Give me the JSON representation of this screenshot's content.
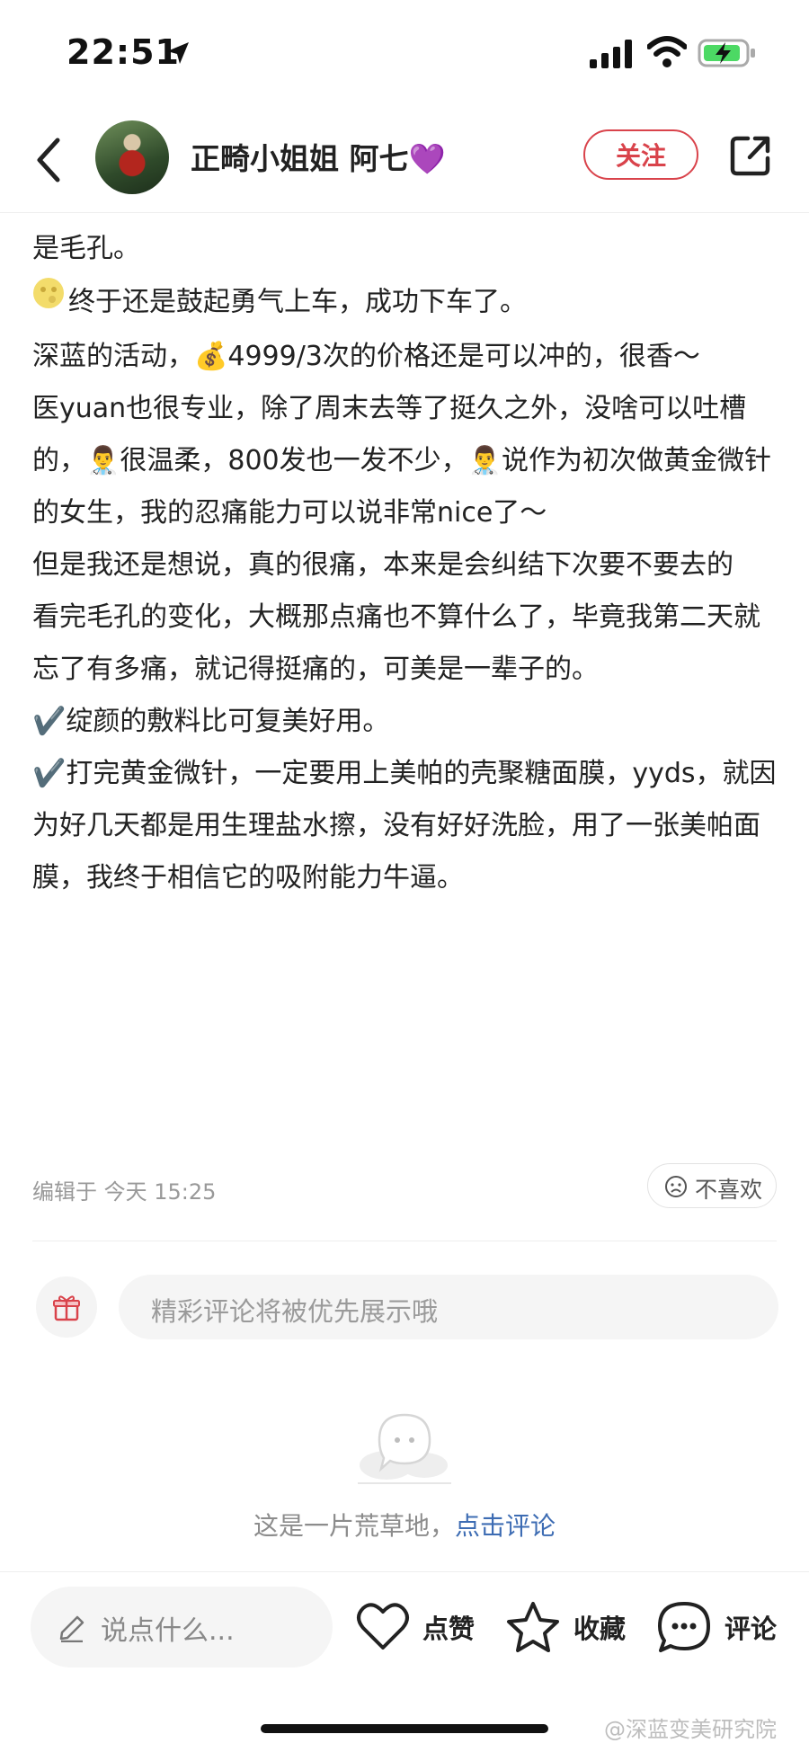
{
  "status_bar": {
    "time": "22:51"
  },
  "header": {
    "username": "正畸小姐姐 阿七💜",
    "follow_label": "关注"
  },
  "post": {
    "paragraphs": [
      "是毛孔。",
      "终于还是鼓起勇气上车，成功下车了。",
      "深蓝的活动，💰4999/3次的价格还是可以冲的，很香～",
      "医yuan也很专业，除了周末去等了挺久之外，没啥可以吐槽的，👨‍⚕️很温柔，800发也一发不少，👨‍⚕️说作为初次做黄金微针的女生，我的忍痛能力可以说非常nice了～",
      "但是我还是想说，真的很痛，本来是会纠结下次要不要去的",
      "看完毛孔的变化，大概那点痛也不算什么了，毕竟我第二天就忘了有多痛，就记得挺痛的，可美是一辈子的。",
      "✔️绽颜的敷料比可复美好用。",
      "✔️打完黄金微针，一定要用上美帕的壳聚糖面膜，yyds，就因为好几天都是用生理盐水擦，没有好好洗脸，用了一张美帕面膜，我终于相信它的吸附能力牛逼。"
    ],
    "edited_time": "编辑于 今天 15:25",
    "dislike_label": "不喜欢"
  },
  "comments": {
    "input_placeholder": "精彩评论将被优先展示哦",
    "empty_text": "这是一片荒草地，",
    "empty_link": "点击评论"
  },
  "bottom_bar": {
    "say_placeholder": "说点什么...",
    "like_label": "点赞",
    "collect_label": "收藏",
    "comment_label": "评论"
  },
  "watermark": "@深蓝变美研究院",
  "colors": {
    "accent": "#d9434b",
    "link": "#3d6cb3"
  }
}
